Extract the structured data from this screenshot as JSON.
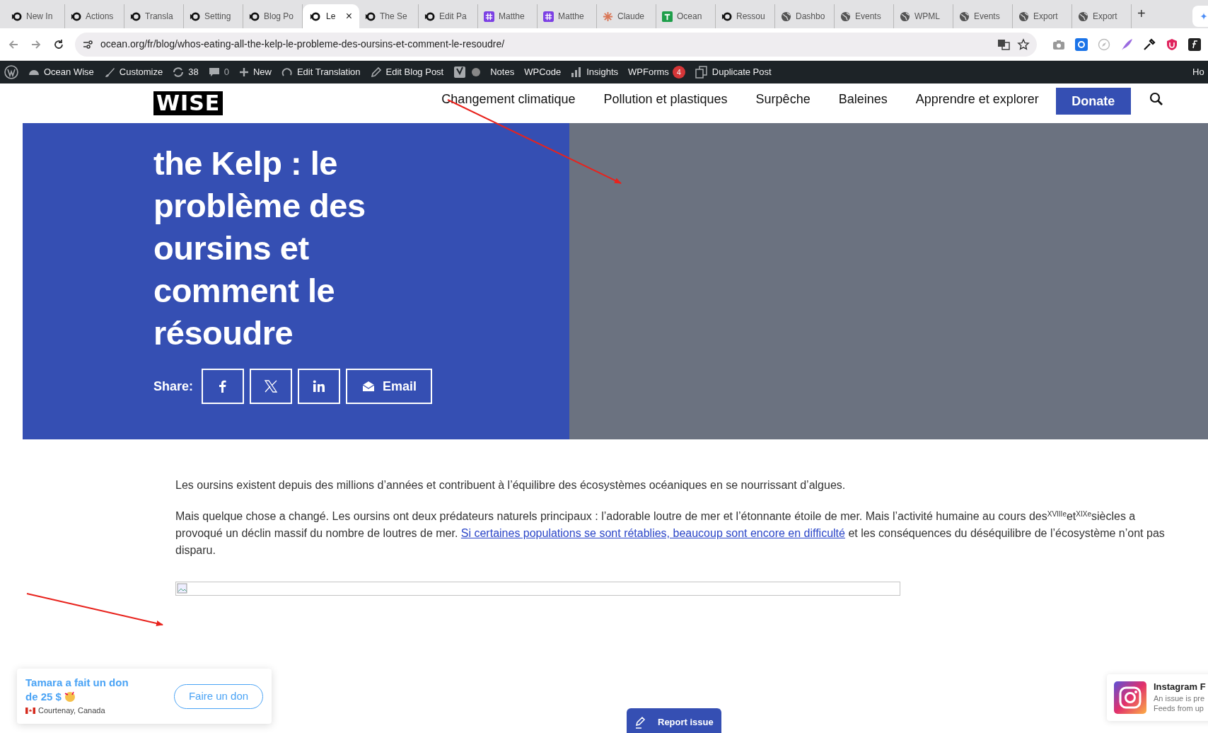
{
  "browser": {
    "tabs": [
      {
        "kind": "ocean",
        "label": "New In",
        "selected": false
      },
      {
        "kind": "ocean",
        "label": "Actions",
        "selected": false
      },
      {
        "kind": "ocean",
        "label": "Transla",
        "selected": false
      },
      {
        "kind": "ocean",
        "label": "Setting",
        "selected": false
      },
      {
        "kind": "ocean",
        "label": "Blog Po",
        "selected": false
      },
      {
        "kind": "ocean",
        "label": "Le",
        "selected": true
      },
      {
        "kind": "ocean",
        "label": "The Se",
        "selected": false
      },
      {
        "kind": "ocean",
        "label": "Edit Pa",
        "selected": false
      },
      {
        "kind": "hash",
        "label": "Matthe",
        "selected": false
      },
      {
        "kind": "hash",
        "label": "Matthe",
        "selected": false
      },
      {
        "kind": "claude",
        "label": "Claude",
        "selected": false
      },
      {
        "kind": "sheet",
        "label": "Ocean",
        "selected": false
      },
      {
        "kind": "ocean",
        "label": "Ressou",
        "selected": false
      },
      {
        "kind": "globe",
        "label": "Dashbo",
        "selected": false
      },
      {
        "kind": "globe",
        "label": "Events",
        "selected": false
      },
      {
        "kind": "globe",
        "label": "WPML",
        "selected": false
      },
      {
        "kind": "globe",
        "label": "Events",
        "selected": false
      },
      {
        "kind": "globe",
        "label": "Export",
        "selected": false
      },
      {
        "kind": "globe",
        "label": "Export",
        "selected": false
      }
    ],
    "close_glyph": "×",
    "new_tab_glyph": "+",
    "url": "ocean.org/fr/blog/whos-eating-all-the-kelp-le-probleme-des-oursins-et-comment-le-resoudre/"
  },
  "admin_bar": {
    "site": "Ocean Wise",
    "customize": "Customize",
    "updates": "38",
    "comments": "0",
    "new": "New",
    "edit_translation": "Edit Translation",
    "edit_post": "Edit Blog Post",
    "notes": "Notes",
    "wpcode": "WPCode",
    "insights": "Insights",
    "wpforms": "WPForms",
    "wpforms_count": "4",
    "duplicate": "Duplicate Post",
    "howdy": "Ho"
  },
  "header": {
    "logo": "WISE",
    "nav": [
      "Changement climatique",
      "Pollution et plastiques",
      "Surpêche",
      "Baleines",
      "Apprendre et explorer"
    ],
    "donate": "Donate"
  },
  "hero": {
    "title": "the Kelp : le problème des oursins et comment le résoudre",
    "share_label": "Share:",
    "share_buttons": [
      {
        "kind": "facebook"
      },
      {
        "kind": "x"
      },
      {
        "kind": "linkedin"
      },
      {
        "kind": "email",
        "label": "Email"
      }
    ]
  },
  "article": {
    "paragraph_1": "Les oursins existent depuis des millions d’années et contribuent à l’équilibre des écosystèmes océaniques en se nourrissant d’algues.",
    "paragraph_2": {
      "before": "Mais quelque chose a changé. Les oursins ont deux prédateurs naturels principaux : l’adorable loutre de mer et l’étonnante étoile de mer. Mais l’activité humaine au cours des$^{XVIIIe}$et$^{XIXe}$siècles a provoqué un déclin massif du nombre de loutres de mer. ",
      "link": "Si certaines populations se sont rétablies, beaucoup sont encore en difficulté",
      "after": " et les conséquences du déséquilibre de l’écosystème n’ont pas disparu."
    }
  },
  "donation_popup": {
    "message_line_1": "Tamara a fait un don",
    "message_line_2": "de 25 $",
    "location": "Courtenay, Canada",
    "button": "Faire un don"
  },
  "report_issue": "Report issue",
  "instagram_notice": {
    "title": "Instagram F",
    "line_1": "An issue is pre",
    "line_2": "Feeds from up"
  }
}
